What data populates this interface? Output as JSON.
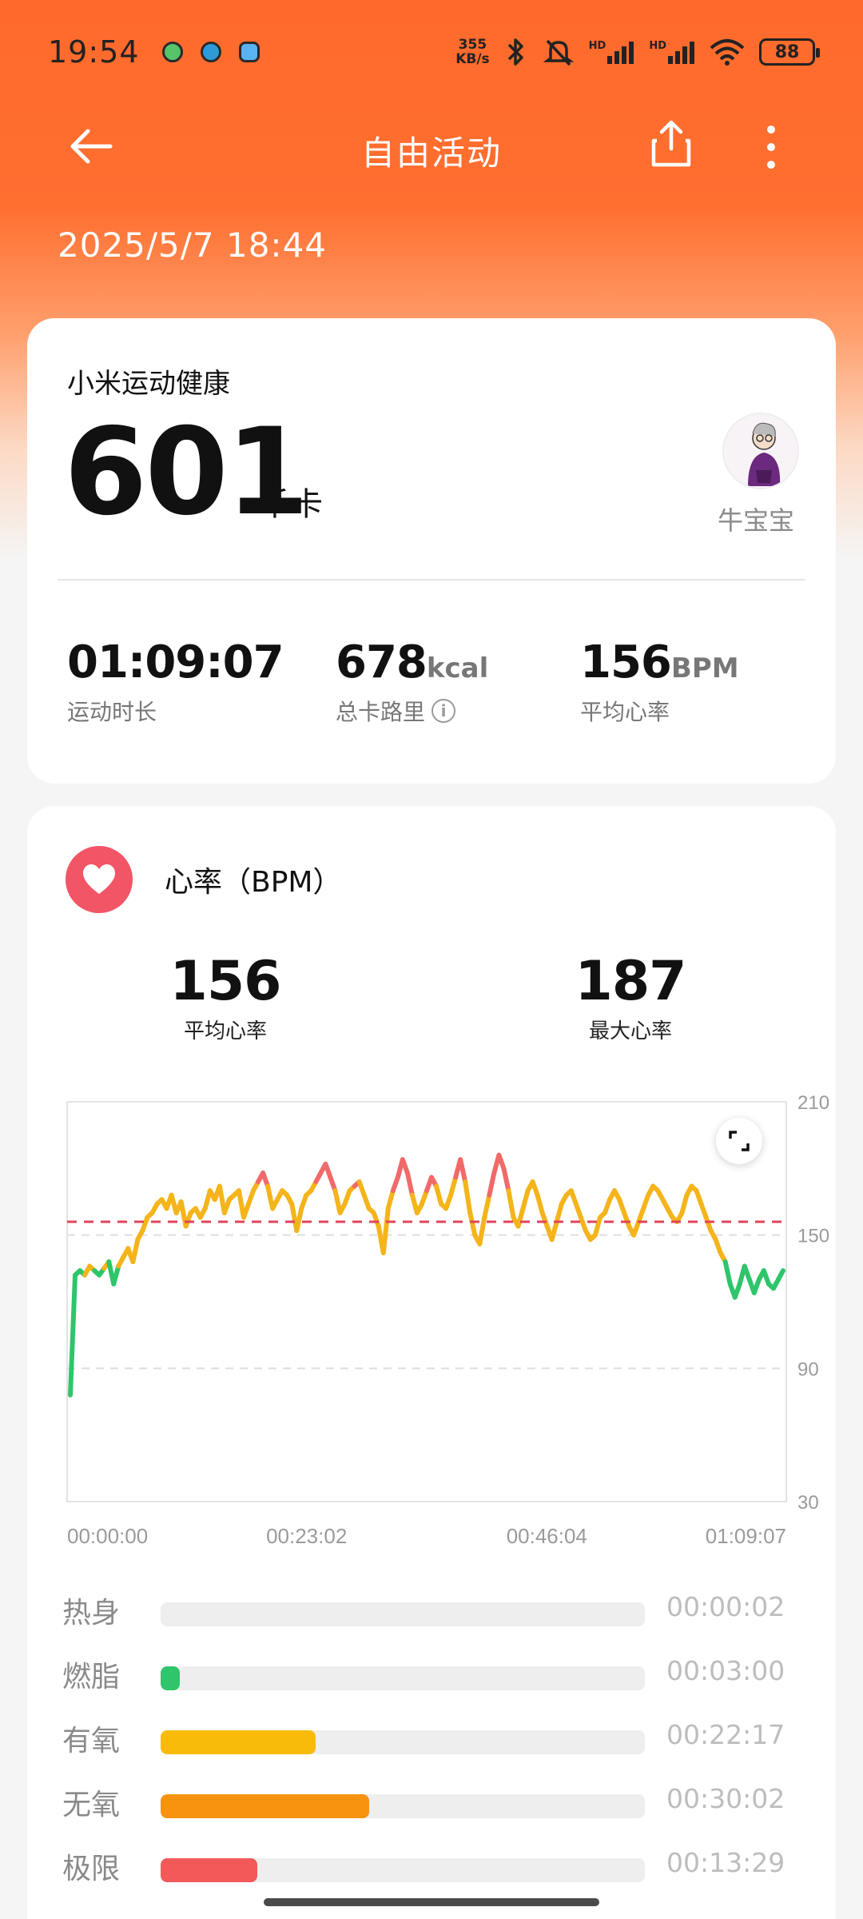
{
  "status_bar": {
    "time": "19:54",
    "net_speed_top": "355",
    "net_speed_bottom": "KB/s",
    "hd1": "HD",
    "hd2": "HD",
    "battery": "88"
  },
  "toolbar": {
    "title": "自由活动",
    "back_icon": "arrow-left-icon",
    "share_icon": "share-icon",
    "more_icon": "more-vertical-icon"
  },
  "datetime": "2025/5/7 18:44",
  "summary": {
    "brand": "小米运动健康",
    "calories": "601",
    "calories_unit": "千卡",
    "user_name": "牛宝宝",
    "stats": [
      {
        "value": "01:09:07",
        "unit": "",
        "label": "运动时长"
      },
      {
        "value": "678",
        "unit": "kcal",
        "label": "总卡路里"
      },
      {
        "value": "156",
        "unit": "BPM",
        "label": "平均心率"
      }
    ]
  },
  "heart_rate": {
    "title": "心率（BPM）",
    "avg_value": "156",
    "avg_label": "平均心率",
    "max_value": "187",
    "max_label": "最大心率"
  },
  "chart_data": {
    "type": "line",
    "ylim": [
      30,
      210
    ],
    "y_ticks": [
      "210",
      "150",
      "90",
      "30"
    ],
    "x_ticks": [
      "00:00:00",
      "00:23:02",
      "00:46:04",
      "01:09:07"
    ],
    "avg_line": 156,
    "series": [
      {
        "values": [
          78,
          132,
          134,
          132,
          136,
          134,
          132,
          135,
          138,
          128,
          136,
          140,
          144,
          138,
          148,
          152,
          158,
          160,
          164,
          166,
          162,
          168,
          160,
          165,
          154,
          160,
          162,
          158,
          162,
          170,
          166,
          172,
          160,
          166,
          168,
          170,
          158,
          164,
          170,
          174,
          178,
          172,
          162,
          166,
          170,
          168,
          164,
          152,
          162,
          168,
          170,
          174,
          178,
          182,
          176,
          170,
          160,
          164,
          170,
          172,
          174,
          168,
          162,
          160,
          154,
          142,
          162,
          170,
          176,
          184,
          178,
          168,
          160,
          164,
          170,
          176,
          172,
          164,
          162,
          168,
          176,
          184,
          174,
          160,
          150,
          146,
          158,
          168,
          178,
          186,
          180,
          170,
          158,
          154,
          162,
          170,
          174,
          168,
          160,
          154,
          148,
          156,
          164,
          168,
          170,
          164,
          158,
          152,
          148,
          150,
          158,
          160,
          166,
          170,
          166,
          160,
          154,
          150,
          156,
          162,
          168,
          172,
          170,
          166,
          162,
          158,
          156,
          160,
          168,
          172,
          170,
          164,
          158,
          152,
          148,
          142,
          138,
          128,
          122,
          128,
          136,
          130,
          124,
          130,
          134,
          128,
          126,
          130,
          134
        ],
        "color_low": "#2ec56b",
        "color_mid": "#f4b41a",
        "color_high": "#f06a6a",
        "color_warm": "#3aa0e8"
      }
    ],
    "grid": true
  },
  "zones": [
    {
      "name": "热身",
      "time": "00:00:02",
      "fraction": 0.0,
      "color": "#3aa0e8"
    },
    {
      "name": "燃脂",
      "time": "00:03:00",
      "fraction": 0.04,
      "color": "#2ec56b"
    },
    {
      "name": "有氧",
      "time": "00:22:17",
      "fraction": 0.32,
      "color": "#f8bb0a"
    },
    {
      "name": "无氧",
      "time": "00:30:02",
      "fraction": 0.43,
      "color": "#f7930f"
    },
    {
      "name": "极限",
      "time": "00:13:29",
      "fraction": 0.2,
      "color": "#f25a5a"
    }
  ],
  "colors": {
    "header": "#ff6a2c",
    "avg_line": "#e0455a",
    "heart_icon_bg": "#f25566"
  }
}
